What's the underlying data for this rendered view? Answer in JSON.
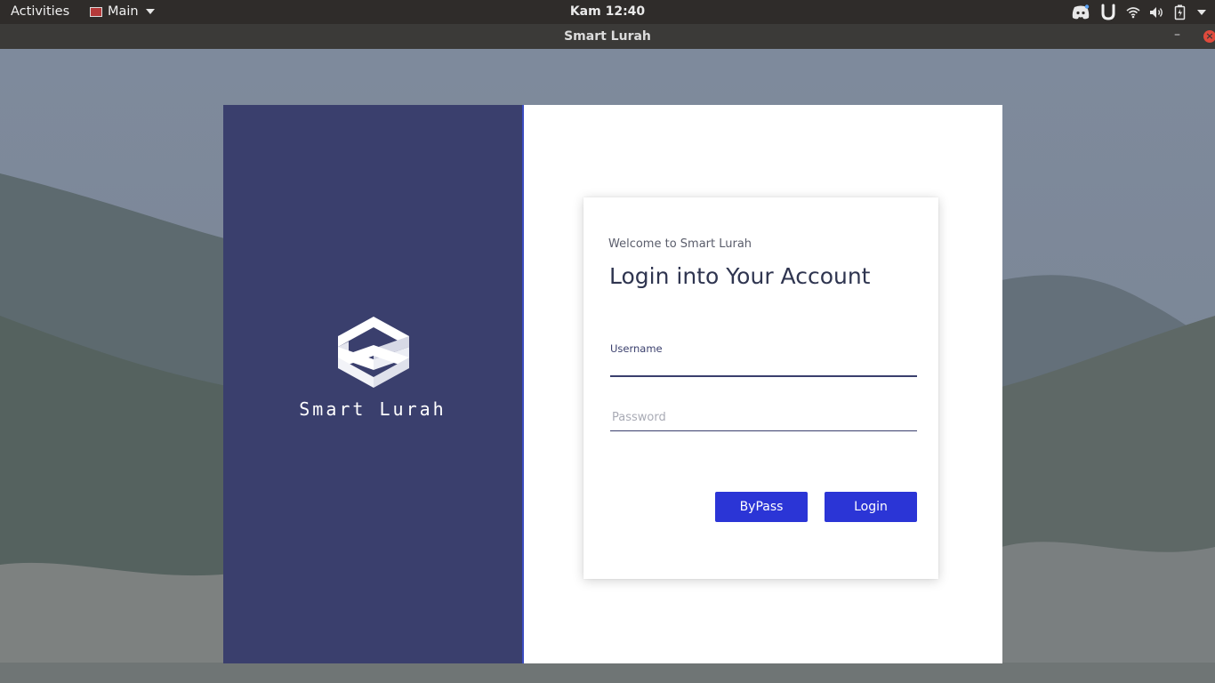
{
  "topbar": {
    "activities": "Activities",
    "app_menu": "Main",
    "clock": "Kam 12:40",
    "tray_icons": [
      "discord-icon",
      "u-app-icon",
      "wifi-icon",
      "volume-icon",
      "battery-icon",
      "system-menu-caret-icon"
    ]
  },
  "window": {
    "title": "Smart Lurah",
    "minimize_label": "–",
    "close_label": "×"
  },
  "brand": {
    "name": "Smart Lurah",
    "panel_color": "#3a3f6d"
  },
  "login": {
    "welcome": "Welcome to Smart Lurah",
    "heading": "Login into Your Account",
    "username_label": "Username",
    "username_value": "",
    "password_placeholder": "Password",
    "bypass_button": "ByPass",
    "login_button": "Login",
    "accent_color": "#2b35d6"
  }
}
